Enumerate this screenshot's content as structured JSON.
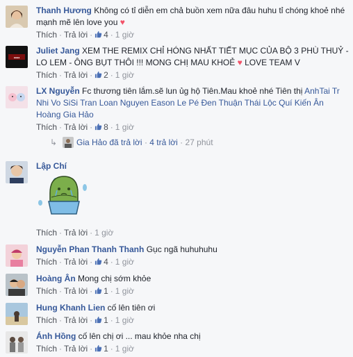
{
  "colors": {
    "link": "#365899",
    "meta": "#90949c",
    "action": "#4b4f56",
    "heart": "#f25268"
  },
  "comments": [
    {
      "author": "Thanh Hương",
      "text": "Không có tỉ diễn em chả buồn xem nữa đâu huhu tỉ chóng khoẻ nhé mạnh mẽ lên love you",
      "like": "Thích",
      "reply": "Trả lời",
      "likes": "4",
      "time": "1 giờ"
    },
    {
      "author": "Juliet Jang",
      "text": "XEM THE REMIX CHỈ HÓNG NHẤT TIẾT MỤC CỦA BỘ 3 PHÙ THUỶ - LO LEM - ÔNG BỤT THÔI !!! MONG CHỊ MAU KHOẺ",
      "text2": "LOVE TEAM V",
      "like": "Thích",
      "reply": "Trả lời",
      "likes": "2",
      "time": "1 giờ"
    },
    {
      "author": "LX Nguyễn",
      "text": "Fc thương tiên lắm.sẽ lun ủg hộ Tiên.Mau khoẻ nhé Tiên thị",
      "tags": "AnhTai Tr Nhi Vo SiSi Tran Loan Nguyen Eason Le Pé Đen Thuận Thái Lộc Quí Kiến Ân Hoàng Gia Hảo",
      "like": "Thích",
      "reply": "Trả lời",
      "likes": "8",
      "time": "1 giờ"
    },
    {
      "author": "Lập Chí",
      "like": "Thích",
      "reply": "Trả lời",
      "time": "1 giờ"
    },
    {
      "author": "Nguyễn Phan Thanh Thanh",
      "text": "Gục ngã huhuhuhu",
      "like": "Thích",
      "reply": "Trả lời",
      "likes": "4",
      "time": "1 giờ"
    },
    {
      "author": "Hoàng Ân",
      "text": "Mong chị sớm khỏe",
      "like": "Thích",
      "reply": "Trả lời",
      "likes": "1",
      "time": "1 giờ"
    },
    {
      "author": "Hung Khanh Lien",
      "text": "cố lên tiên ơi",
      "like": "Thích",
      "reply": "Trả lời",
      "likes": "1",
      "time": "1 giờ"
    },
    {
      "author": "Ánh Hồng",
      "text": "cố lên chị ơi ... mau khỏe nha chị",
      "like": "Thích",
      "reply": "Trả lời",
      "likes": "1",
      "time": "1 giờ"
    }
  ],
  "reply_summary": {
    "name": "Gia Hảo",
    "text": "đã trả lời",
    "count": "4 trả lời",
    "time": "27 phút"
  }
}
